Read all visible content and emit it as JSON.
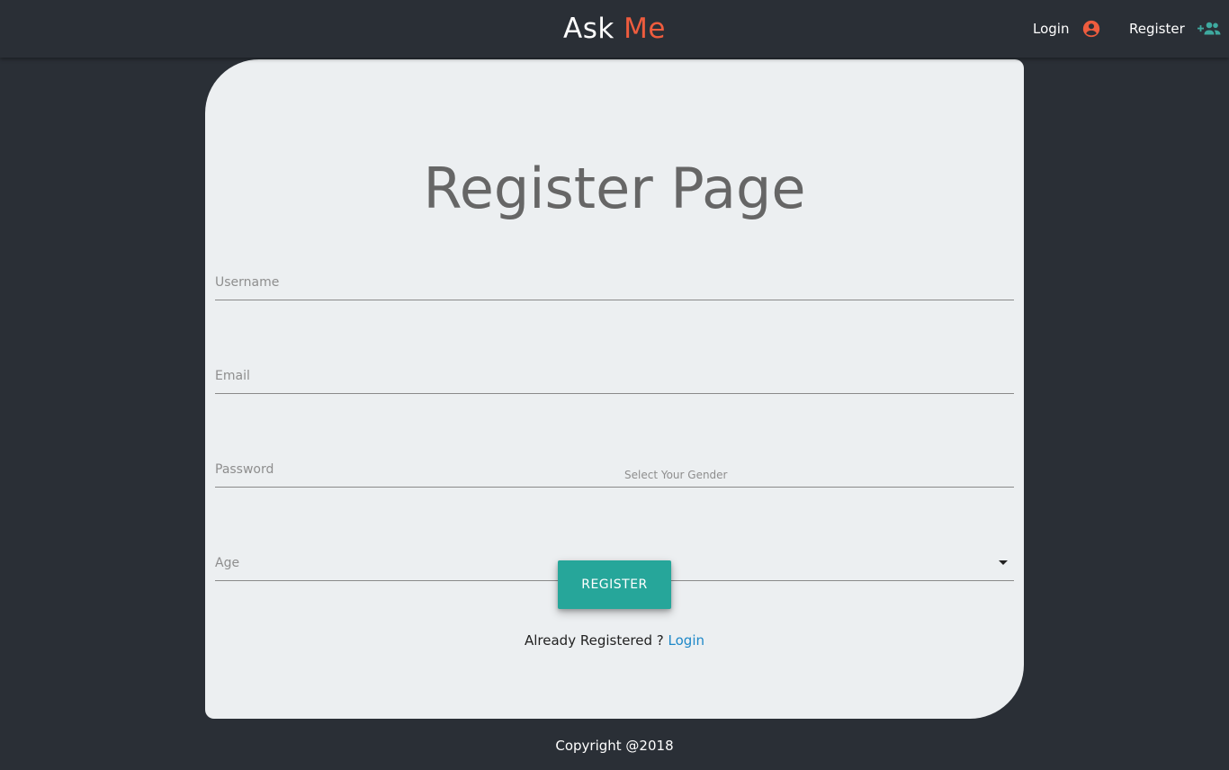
{
  "header": {
    "brand_main": "Ask",
    "brand_accent": "Me",
    "login_label": "Login",
    "login_icon": "account-circle-icon",
    "register_label": "Register",
    "register_icon": "group-add-icon"
  },
  "form": {
    "title": "Register Page",
    "username_placeholder": "Username",
    "email_placeholder": "Email",
    "password_placeholder": "Password",
    "age_placeholder": "Age",
    "gender_label": "Select Your Gender",
    "gender_value": "",
    "submit_label": "REGISTER",
    "already_text": "Already Registered ?",
    "login_link": "Login"
  },
  "footer": {
    "copyright": "Copyright @2018"
  },
  "colors": {
    "background": "#2a2f36",
    "card": "#eceff1",
    "brand_accent": "#ee5c3e",
    "button": "#26a69a",
    "link": "#1e88c8",
    "register_icon": "#3ea99f"
  }
}
